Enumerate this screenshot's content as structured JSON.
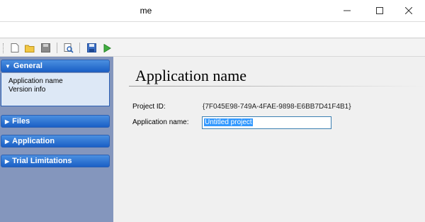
{
  "window": {
    "title": "me"
  },
  "toolbar": {
    "buttons": [
      {
        "icon": "new-file-icon"
      },
      {
        "icon": "open-folder-icon"
      },
      {
        "icon": "save-icon"
      },
      {
        "icon": "preview-icon"
      },
      {
        "icon": "save-disk-icon"
      },
      {
        "icon": "run-icon"
      }
    ]
  },
  "sidebar": {
    "groups": [
      {
        "label": "General",
        "expanded": true,
        "items": [
          "Application name",
          "Version info"
        ]
      },
      {
        "label": "Files",
        "expanded": false
      },
      {
        "label": "Application",
        "expanded": false
      },
      {
        "label": "Trial Limitations",
        "expanded": false
      }
    ]
  },
  "main": {
    "title": "Application name",
    "fields": {
      "project_id_label": "Project ID:",
      "project_id_value": "{7F045E98-749A-4FAE-9898-E6BB7D41F4B1}",
      "app_name_label": "Application name:",
      "app_name_value": "Untitled project"
    }
  },
  "colors": {
    "sidebar_bg": "#8496bd",
    "group_header": "#1a5fc6",
    "group_body": "#dde8f6",
    "selection": "#3399ff"
  }
}
